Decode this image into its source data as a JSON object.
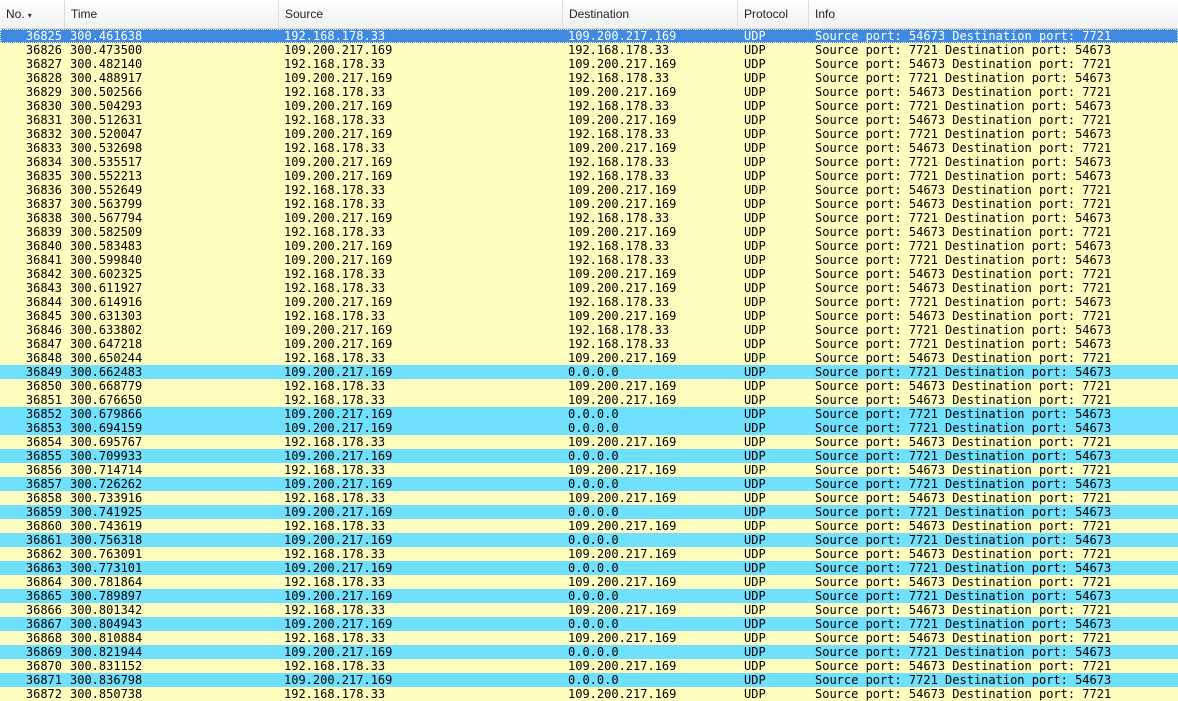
{
  "columns": {
    "no": "No.",
    "time": "Time",
    "source": "Source",
    "destination": "Destination",
    "protocol": "Protocol",
    "info": "Info"
  },
  "sort_icon": "sort-descending-icon",
  "colors": {
    "udp_row": "#ffffc0",
    "highlight_row": "#70e0ff",
    "selected_row": "#3f8ae0"
  },
  "rows": [
    {
      "no": "36825",
      "time": "300.461638",
      "src": "192.168.178.33",
      "dst": "109.200.217.169",
      "proto": "UDP",
      "info": "Source port: 54673  Destination port: 7721",
      "color": "selected"
    },
    {
      "no": "36826",
      "time": "300.473500",
      "src": "109.200.217.169",
      "dst": "192.168.178.33",
      "proto": "UDP",
      "info": "Source port: 7721  Destination port: 54673",
      "color": "yellow"
    },
    {
      "no": "36827",
      "time": "300.482140",
      "src": "192.168.178.33",
      "dst": "109.200.217.169",
      "proto": "UDP",
      "info": "Source port: 54673  Destination port: 7721",
      "color": "yellow"
    },
    {
      "no": "36828",
      "time": "300.488917",
      "src": "109.200.217.169",
      "dst": "192.168.178.33",
      "proto": "UDP",
      "info": "Source port: 7721  Destination port: 54673",
      "color": "yellow"
    },
    {
      "no": "36829",
      "time": "300.502566",
      "src": "192.168.178.33",
      "dst": "109.200.217.169",
      "proto": "UDP",
      "info": "Source port: 54673  Destination port: 7721",
      "color": "yellow"
    },
    {
      "no": "36830",
      "time": "300.504293",
      "src": "109.200.217.169",
      "dst": "192.168.178.33",
      "proto": "UDP",
      "info": "Source port: 7721  Destination port: 54673",
      "color": "yellow"
    },
    {
      "no": "36831",
      "time": "300.512631",
      "src": "192.168.178.33",
      "dst": "109.200.217.169",
      "proto": "UDP",
      "info": "Source port: 54673  Destination port: 7721",
      "color": "yellow"
    },
    {
      "no": "36832",
      "time": "300.520047",
      "src": "109.200.217.169",
      "dst": "192.168.178.33",
      "proto": "UDP",
      "info": "Source port: 7721  Destination port: 54673",
      "color": "yellow"
    },
    {
      "no": "36833",
      "time": "300.532698",
      "src": "192.168.178.33",
      "dst": "109.200.217.169",
      "proto": "UDP",
      "info": "Source port: 54673  Destination port: 7721",
      "color": "yellow"
    },
    {
      "no": "36834",
      "time": "300.535517",
      "src": "109.200.217.169",
      "dst": "192.168.178.33",
      "proto": "UDP",
      "info": "Source port: 7721  Destination port: 54673",
      "color": "yellow"
    },
    {
      "no": "36835",
      "time": "300.552213",
      "src": "109.200.217.169",
      "dst": "192.168.178.33",
      "proto": "UDP",
      "info": "Source port: 7721  Destination port: 54673",
      "color": "yellow"
    },
    {
      "no": "36836",
      "time": "300.552649",
      "src": "192.168.178.33",
      "dst": "109.200.217.169",
      "proto": "UDP",
      "info": "Source port: 54673  Destination port: 7721",
      "color": "yellow"
    },
    {
      "no": "36837",
      "time": "300.563799",
      "src": "192.168.178.33",
      "dst": "109.200.217.169",
      "proto": "UDP",
      "info": "Source port: 54673  Destination port: 7721",
      "color": "yellow"
    },
    {
      "no": "36838",
      "time": "300.567794",
      "src": "109.200.217.169",
      "dst": "192.168.178.33",
      "proto": "UDP",
      "info": "Source port: 7721  Destination port: 54673",
      "color": "yellow"
    },
    {
      "no": "36839",
      "time": "300.582509",
      "src": "192.168.178.33",
      "dst": "109.200.217.169",
      "proto": "UDP",
      "info": "Source port: 54673  Destination port: 7721",
      "color": "yellow"
    },
    {
      "no": "36840",
      "time": "300.583483",
      "src": "109.200.217.169",
      "dst": "192.168.178.33",
      "proto": "UDP",
      "info": "Source port: 7721  Destination port: 54673",
      "color": "yellow"
    },
    {
      "no": "36841",
      "time": "300.599840",
      "src": "109.200.217.169",
      "dst": "192.168.178.33",
      "proto": "UDP",
      "info": "Source port: 7721  Destination port: 54673",
      "color": "yellow"
    },
    {
      "no": "36842",
      "time": "300.602325",
      "src": "192.168.178.33",
      "dst": "109.200.217.169",
      "proto": "UDP",
      "info": "Source port: 54673  Destination port: 7721",
      "color": "yellow"
    },
    {
      "no": "36843",
      "time": "300.611927",
      "src": "192.168.178.33",
      "dst": "109.200.217.169",
      "proto": "UDP",
      "info": "Source port: 54673  Destination port: 7721",
      "color": "yellow"
    },
    {
      "no": "36844",
      "time": "300.614916",
      "src": "109.200.217.169",
      "dst": "192.168.178.33",
      "proto": "UDP",
      "info": "Source port: 7721  Destination port: 54673",
      "color": "yellow"
    },
    {
      "no": "36845",
      "time": "300.631303",
      "src": "192.168.178.33",
      "dst": "109.200.217.169",
      "proto": "UDP",
      "info": "Source port: 54673  Destination port: 7721",
      "color": "yellow"
    },
    {
      "no": "36846",
      "time": "300.633802",
      "src": "109.200.217.169",
      "dst": "192.168.178.33",
      "proto": "UDP",
      "info": "Source port: 7721  Destination port: 54673",
      "color": "yellow"
    },
    {
      "no": "36847",
      "time": "300.647218",
      "src": "109.200.217.169",
      "dst": "192.168.178.33",
      "proto": "UDP",
      "info": "Source port: 7721  Destination port: 54673",
      "color": "yellow"
    },
    {
      "no": "36848",
      "time": "300.650244",
      "src": "192.168.178.33",
      "dst": "109.200.217.169",
      "proto": "UDP",
      "info": "Source port: 54673  Destination port: 7721",
      "color": "yellow"
    },
    {
      "no": "36849",
      "time": "300.662483",
      "src": "109.200.217.169",
      "dst": "0.0.0.0",
      "proto": "UDP",
      "info": "Source port: 7721  Destination port: 54673",
      "color": "cyan"
    },
    {
      "no": "36850",
      "time": "300.668779",
      "src": "192.168.178.33",
      "dst": "109.200.217.169",
      "proto": "UDP",
      "info": "Source port: 54673  Destination port: 7721",
      "color": "yellow"
    },
    {
      "no": "36851",
      "time": "300.676650",
      "src": "192.168.178.33",
      "dst": "109.200.217.169",
      "proto": "UDP",
      "info": "Source port: 54673  Destination port: 7721",
      "color": "yellow"
    },
    {
      "no": "36852",
      "time": "300.679866",
      "src": "109.200.217.169",
      "dst": "0.0.0.0",
      "proto": "UDP",
      "info": "Source port: 7721  Destination port: 54673",
      "color": "cyan"
    },
    {
      "no": "36853",
      "time": "300.694159",
      "src": "109.200.217.169",
      "dst": "0.0.0.0",
      "proto": "UDP",
      "info": "Source port: 7721  Destination port: 54673",
      "color": "cyan"
    },
    {
      "no": "36854",
      "time": "300.695767",
      "src": "192.168.178.33",
      "dst": "109.200.217.169",
      "proto": "UDP",
      "info": "Source port: 54673  Destination port: 7721",
      "color": "yellow"
    },
    {
      "no": "36855",
      "time": "300.709933",
      "src": "109.200.217.169",
      "dst": "0.0.0.0",
      "proto": "UDP",
      "info": "Source port: 7721  Destination port: 54673",
      "color": "cyan"
    },
    {
      "no": "36856",
      "time": "300.714714",
      "src": "192.168.178.33",
      "dst": "109.200.217.169",
      "proto": "UDP",
      "info": "Source port: 54673  Destination port: 7721",
      "color": "yellow"
    },
    {
      "no": "36857",
      "time": "300.726262",
      "src": "109.200.217.169",
      "dst": "0.0.0.0",
      "proto": "UDP",
      "info": "Source port: 7721  Destination port: 54673",
      "color": "cyan"
    },
    {
      "no": "36858",
      "time": "300.733916",
      "src": "192.168.178.33",
      "dst": "109.200.217.169",
      "proto": "UDP",
      "info": "Source port: 54673  Destination port: 7721",
      "color": "yellow"
    },
    {
      "no": "36859",
      "time": "300.741925",
      "src": "109.200.217.169",
      "dst": "0.0.0.0",
      "proto": "UDP",
      "info": "Source port: 7721  Destination port: 54673",
      "color": "cyan"
    },
    {
      "no": "36860",
      "time": "300.743619",
      "src": "192.168.178.33",
      "dst": "109.200.217.169",
      "proto": "UDP",
      "info": "Source port: 54673  Destination port: 7721",
      "color": "yellow"
    },
    {
      "no": "36861",
      "time": "300.756318",
      "src": "109.200.217.169",
      "dst": "0.0.0.0",
      "proto": "UDP",
      "info": "Source port: 7721  Destination port: 54673",
      "color": "cyan"
    },
    {
      "no": "36862",
      "time": "300.763091",
      "src": "192.168.178.33",
      "dst": "109.200.217.169",
      "proto": "UDP",
      "info": "Source port: 54673  Destination port: 7721",
      "color": "yellow"
    },
    {
      "no": "36863",
      "time": "300.773101",
      "src": "109.200.217.169",
      "dst": "0.0.0.0",
      "proto": "UDP",
      "info": "Source port: 7721  Destination port: 54673",
      "color": "cyan"
    },
    {
      "no": "36864",
      "time": "300.781864",
      "src": "192.168.178.33",
      "dst": "109.200.217.169",
      "proto": "UDP",
      "info": "Source port: 54673  Destination port: 7721",
      "color": "yellow"
    },
    {
      "no": "36865",
      "time": "300.789897",
      "src": "109.200.217.169",
      "dst": "0.0.0.0",
      "proto": "UDP",
      "info": "Source port: 7721  Destination port: 54673",
      "color": "cyan"
    },
    {
      "no": "36866",
      "time": "300.801342",
      "src": "192.168.178.33",
      "dst": "109.200.217.169",
      "proto": "UDP",
      "info": "Source port: 54673  Destination port: 7721",
      "color": "yellow"
    },
    {
      "no": "36867",
      "time": "300.804943",
      "src": "109.200.217.169",
      "dst": "0.0.0.0",
      "proto": "UDP",
      "info": "Source port: 7721  Destination port: 54673",
      "color": "cyan"
    },
    {
      "no": "36868",
      "time": "300.810884",
      "src": "192.168.178.33",
      "dst": "109.200.217.169",
      "proto": "UDP",
      "info": "Source port: 54673  Destination port: 7721",
      "color": "yellow"
    },
    {
      "no": "36869",
      "time": "300.821944",
      "src": "109.200.217.169",
      "dst": "0.0.0.0",
      "proto": "UDP",
      "info": "Source port: 7721  Destination port: 54673",
      "color": "cyan"
    },
    {
      "no": "36870",
      "time": "300.831152",
      "src": "192.168.178.33",
      "dst": "109.200.217.169",
      "proto": "UDP",
      "info": "Source port: 54673  Destination port: 7721",
      "color": "yellow"
    },
    {
      "no": "36871",
      "time": "300.836798",
      "src": "109.200.217.169",
      "dst": "0.0.0.0",
      "proto": "UDP",
      "info": "Source port: 7721  Destination port: 54673",
      "color": "cyan"
    },
    {
      "no": "36872",
      "time": "300.850738",
      "src": "192.168.178.33",
      "dst": "109.200.217.169",
      "proto": "UDP",
      "info": "Source port: 54673  Destination port: 7721",
      "color": "yellow"
    }
  ]
}
